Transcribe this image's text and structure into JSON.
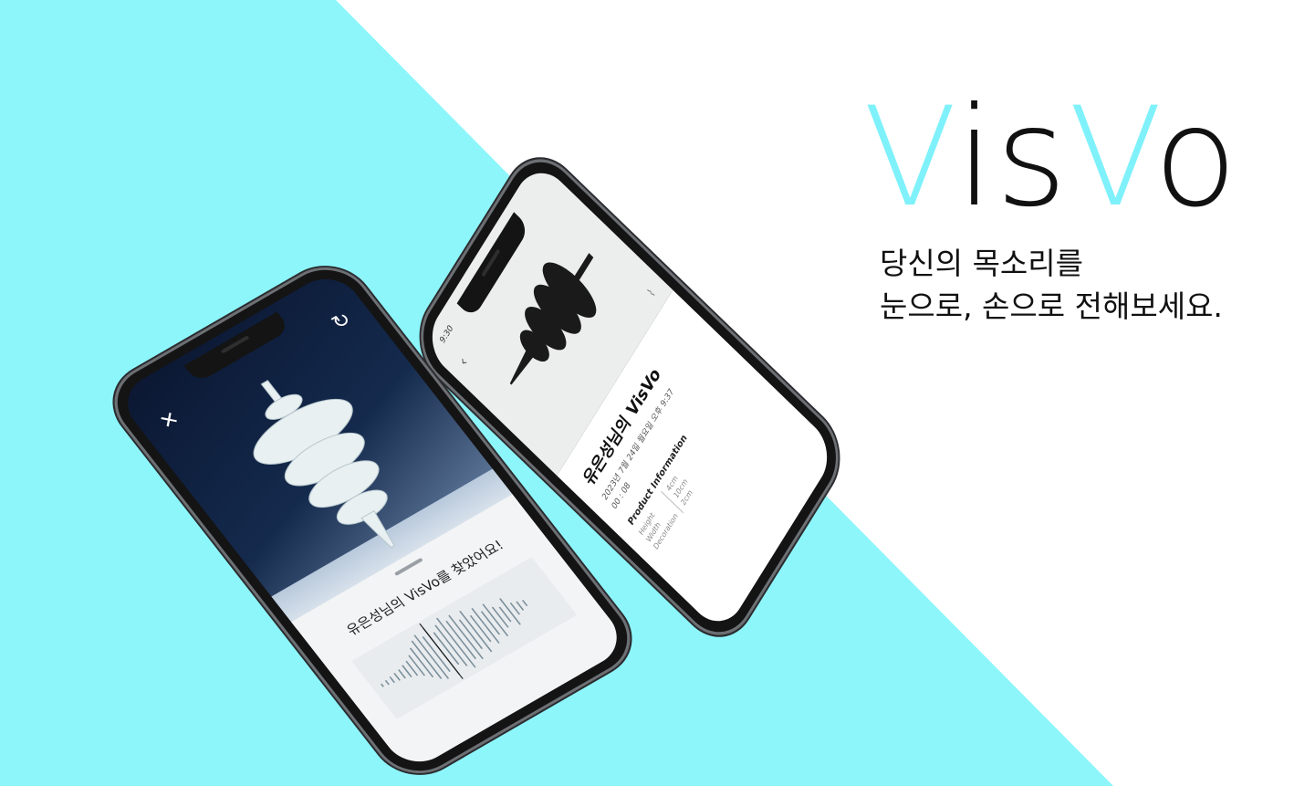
{
  "brand": {
    "logo_part1": "V",
    "logo_part2": "is",
    "logo_part3": "V",
    "logo_part4": "o",
    "accent_color": "#7ff1fa",
    "text_color": "#111111"
  },
  "tagline": {
    "line1": "당신의 목소리를",
    "line2": "눈으로, 손으로 전해보세요."
  },
  "phone_recording": {
    "close_icon": "close-icon",
    "refresh_icon": "refresh-icon",
    "found_message": "유은성님의 VisVo를 찾았어요!"
  },
  "phone_result": {
    "time": "9:30",
    "back_icon": "chevron-left-icon",
    "clip_icon": "paperclip-icon",
    "title": "유은성님의 VisVo",
    "date": "2023년 7월 24일 월요일 오후 9:37",
    "duration": "00 : 08",
    "section_title": "Product Information",
    "specs": [
      {
        "label": "Height",
        "value": "4cm"
      },
      {
        "label": "Width",
        "value": "10cm"
      },
      {
        "label": "Decoration",
        "value": "2cm"
      }
    ]
  }
}
